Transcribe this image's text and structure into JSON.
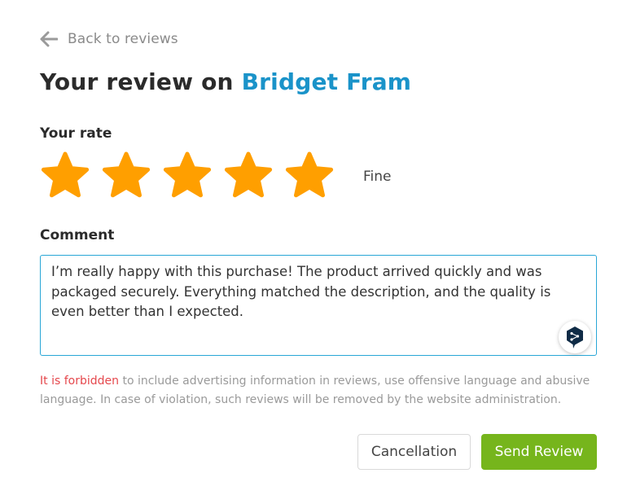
{
  "back_link": {
    "label": "Back to reviews",
    "icon": "arrow-left-icon"
  },
  "header": {
    "title_prefix": "Your review on",
    "seller_name": "Bridget Fram"
  },
  "rating": {
    "label": "Your rate",
    "value": 5,
    "max": 5,
    "text": "Fine",
    "star_color": "#ff9f00"
  },
  "comment": {
    "label": "Comment",
    "value": "I’m really happy with this purchase! The product arrived quickly and was packaged securely. Everything matched the description, and the quality is even better than I expected.",
    "assist_icon": "deepl-translate-icon"
  },
  "notice": {
    "warning": "It is forbidden",
    "text": "to include advertising information in reviews, use offensive language and abusive language. In case of violation, such reviews will be removed by the website administration."
  },
  "actions": {
    "cancel_label": "Cancellation",
    "submit_label": "Send Review"
  },
  "colors": {
    "accent": "#1a93c9",
    "submit": "#76b51c",
    "warning": "#e5484d",
    "focus_border": "#29a6d6"
  }
}
